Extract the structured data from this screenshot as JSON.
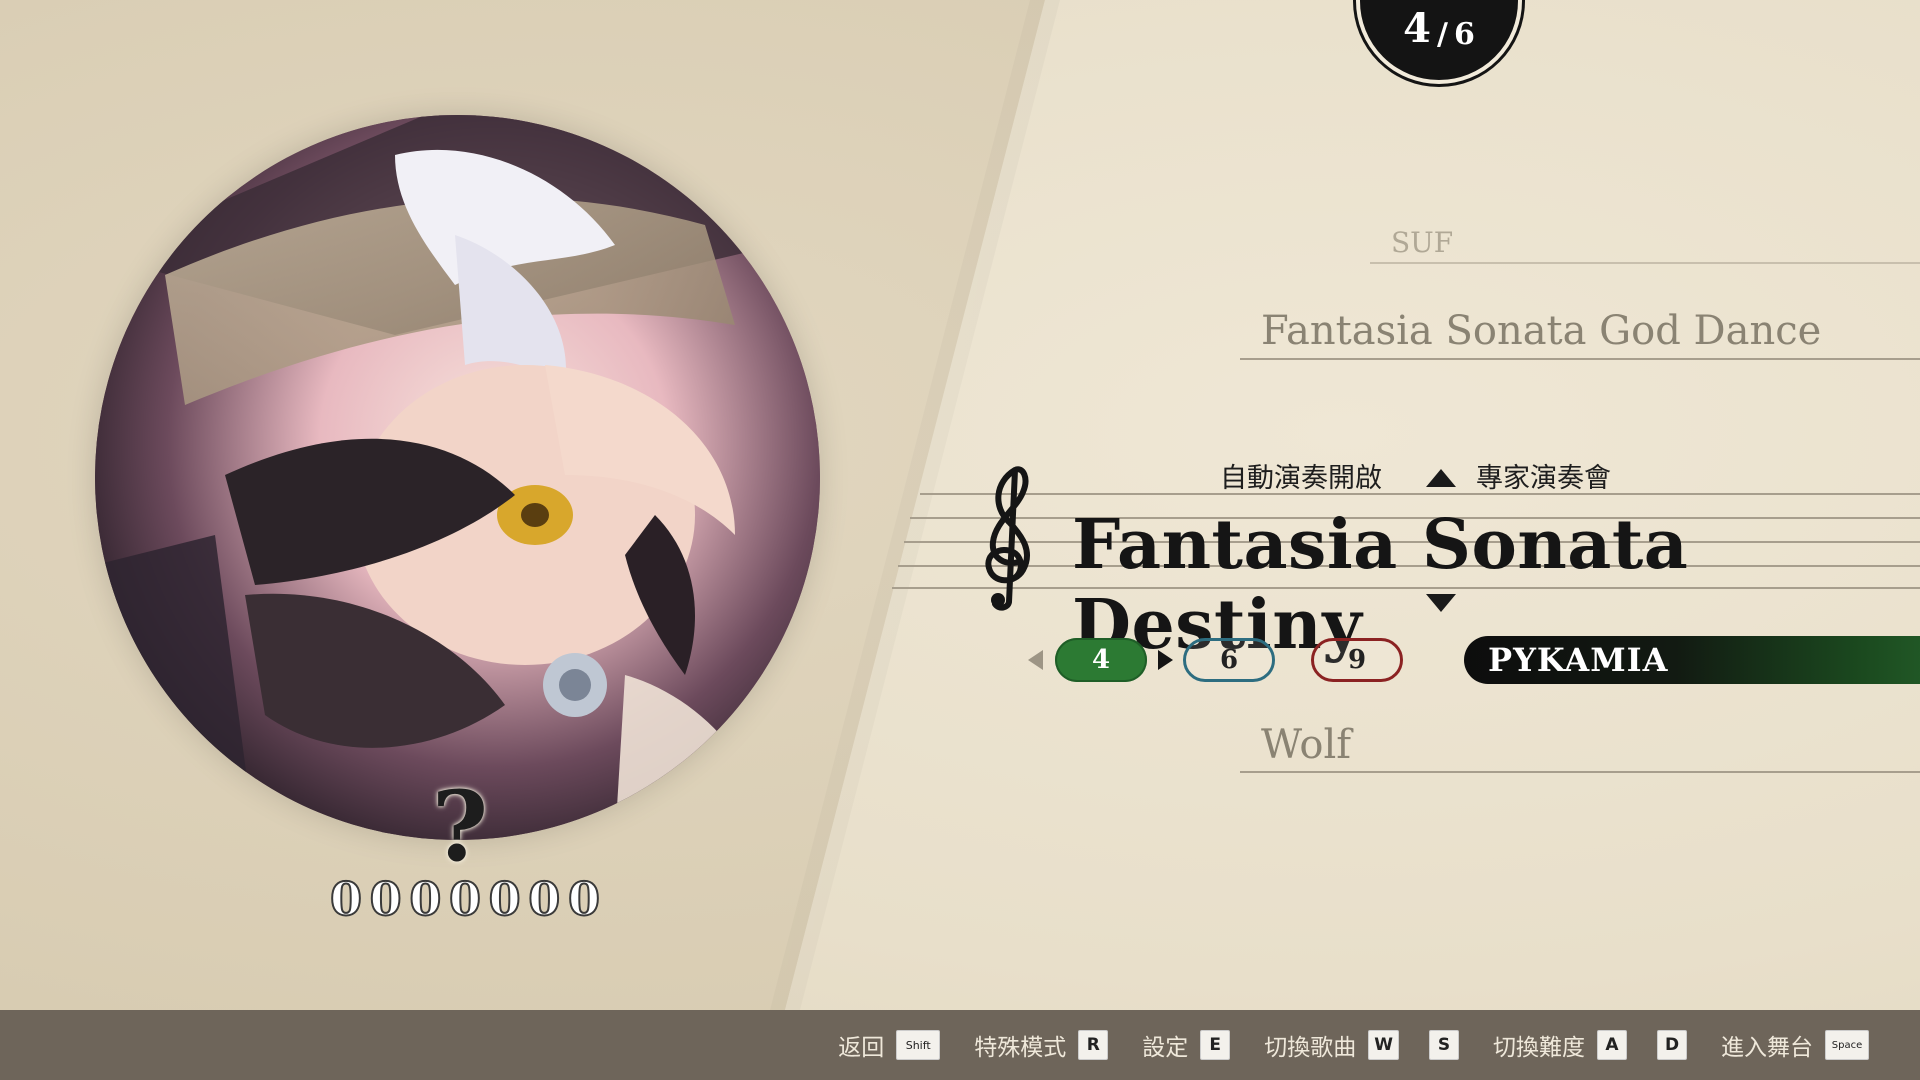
{
  "counter": {
    "current": "4",
    "separator": "/",
    "total": "6"
  },
  "jacket": {
    "alt": "song jacket artwork"
  },
  "record": {
    "grade": "?",
    "score_digits": [
      "0",
      "0",
      "0",
      "0",
      "0",
      "0",
      "0"
    ]
  },
  "song_list": {
    "prev2": "SUF",
    "prev1": "Fantasia Sonata God Dance",
    "current": "Fantasia Sonata Destiny",
    "next1": "Wolf"
  },
  "current_song": {
    "autoplay_label": "自動演奏開啟",
    "mode_label": "專家演奏會"
  },
  "difficulties": [
    {
      "level": "4",
      "selected": true,
      "color": "#2c7a33"
    },
    {
      "level": "6",
      "selected": false,
      "color": "#2d6d80"
    },
    {
      "level": "9",
      "selected": false,
      "color": "#8b2222"
    }
  ],
  "charter": "PYKAMIA",
  "controls": {
    "back": {
      "label": "返回",
      "keys": [
        "Shift"
      ]
    },
    "special": {
      "label": "特殊模式",
      "keys": [
        "R"
      ]
    },
    "settings": {
      "label": "設定",
      "keys": [
        "E"
      ]
    },
    "switch_song": {
      "label": "切換歌曲",
      "keys": [
        "W",
        "S"
      ]
    },
    "switch_diff": {
      "label": "切換難度",
      "keys": [
        "A",
        "D"
      ]
    },
    "enter": {
      "label": "進入舞台",
      "keys": [
        "Space"
      ]
    }
  }
}
